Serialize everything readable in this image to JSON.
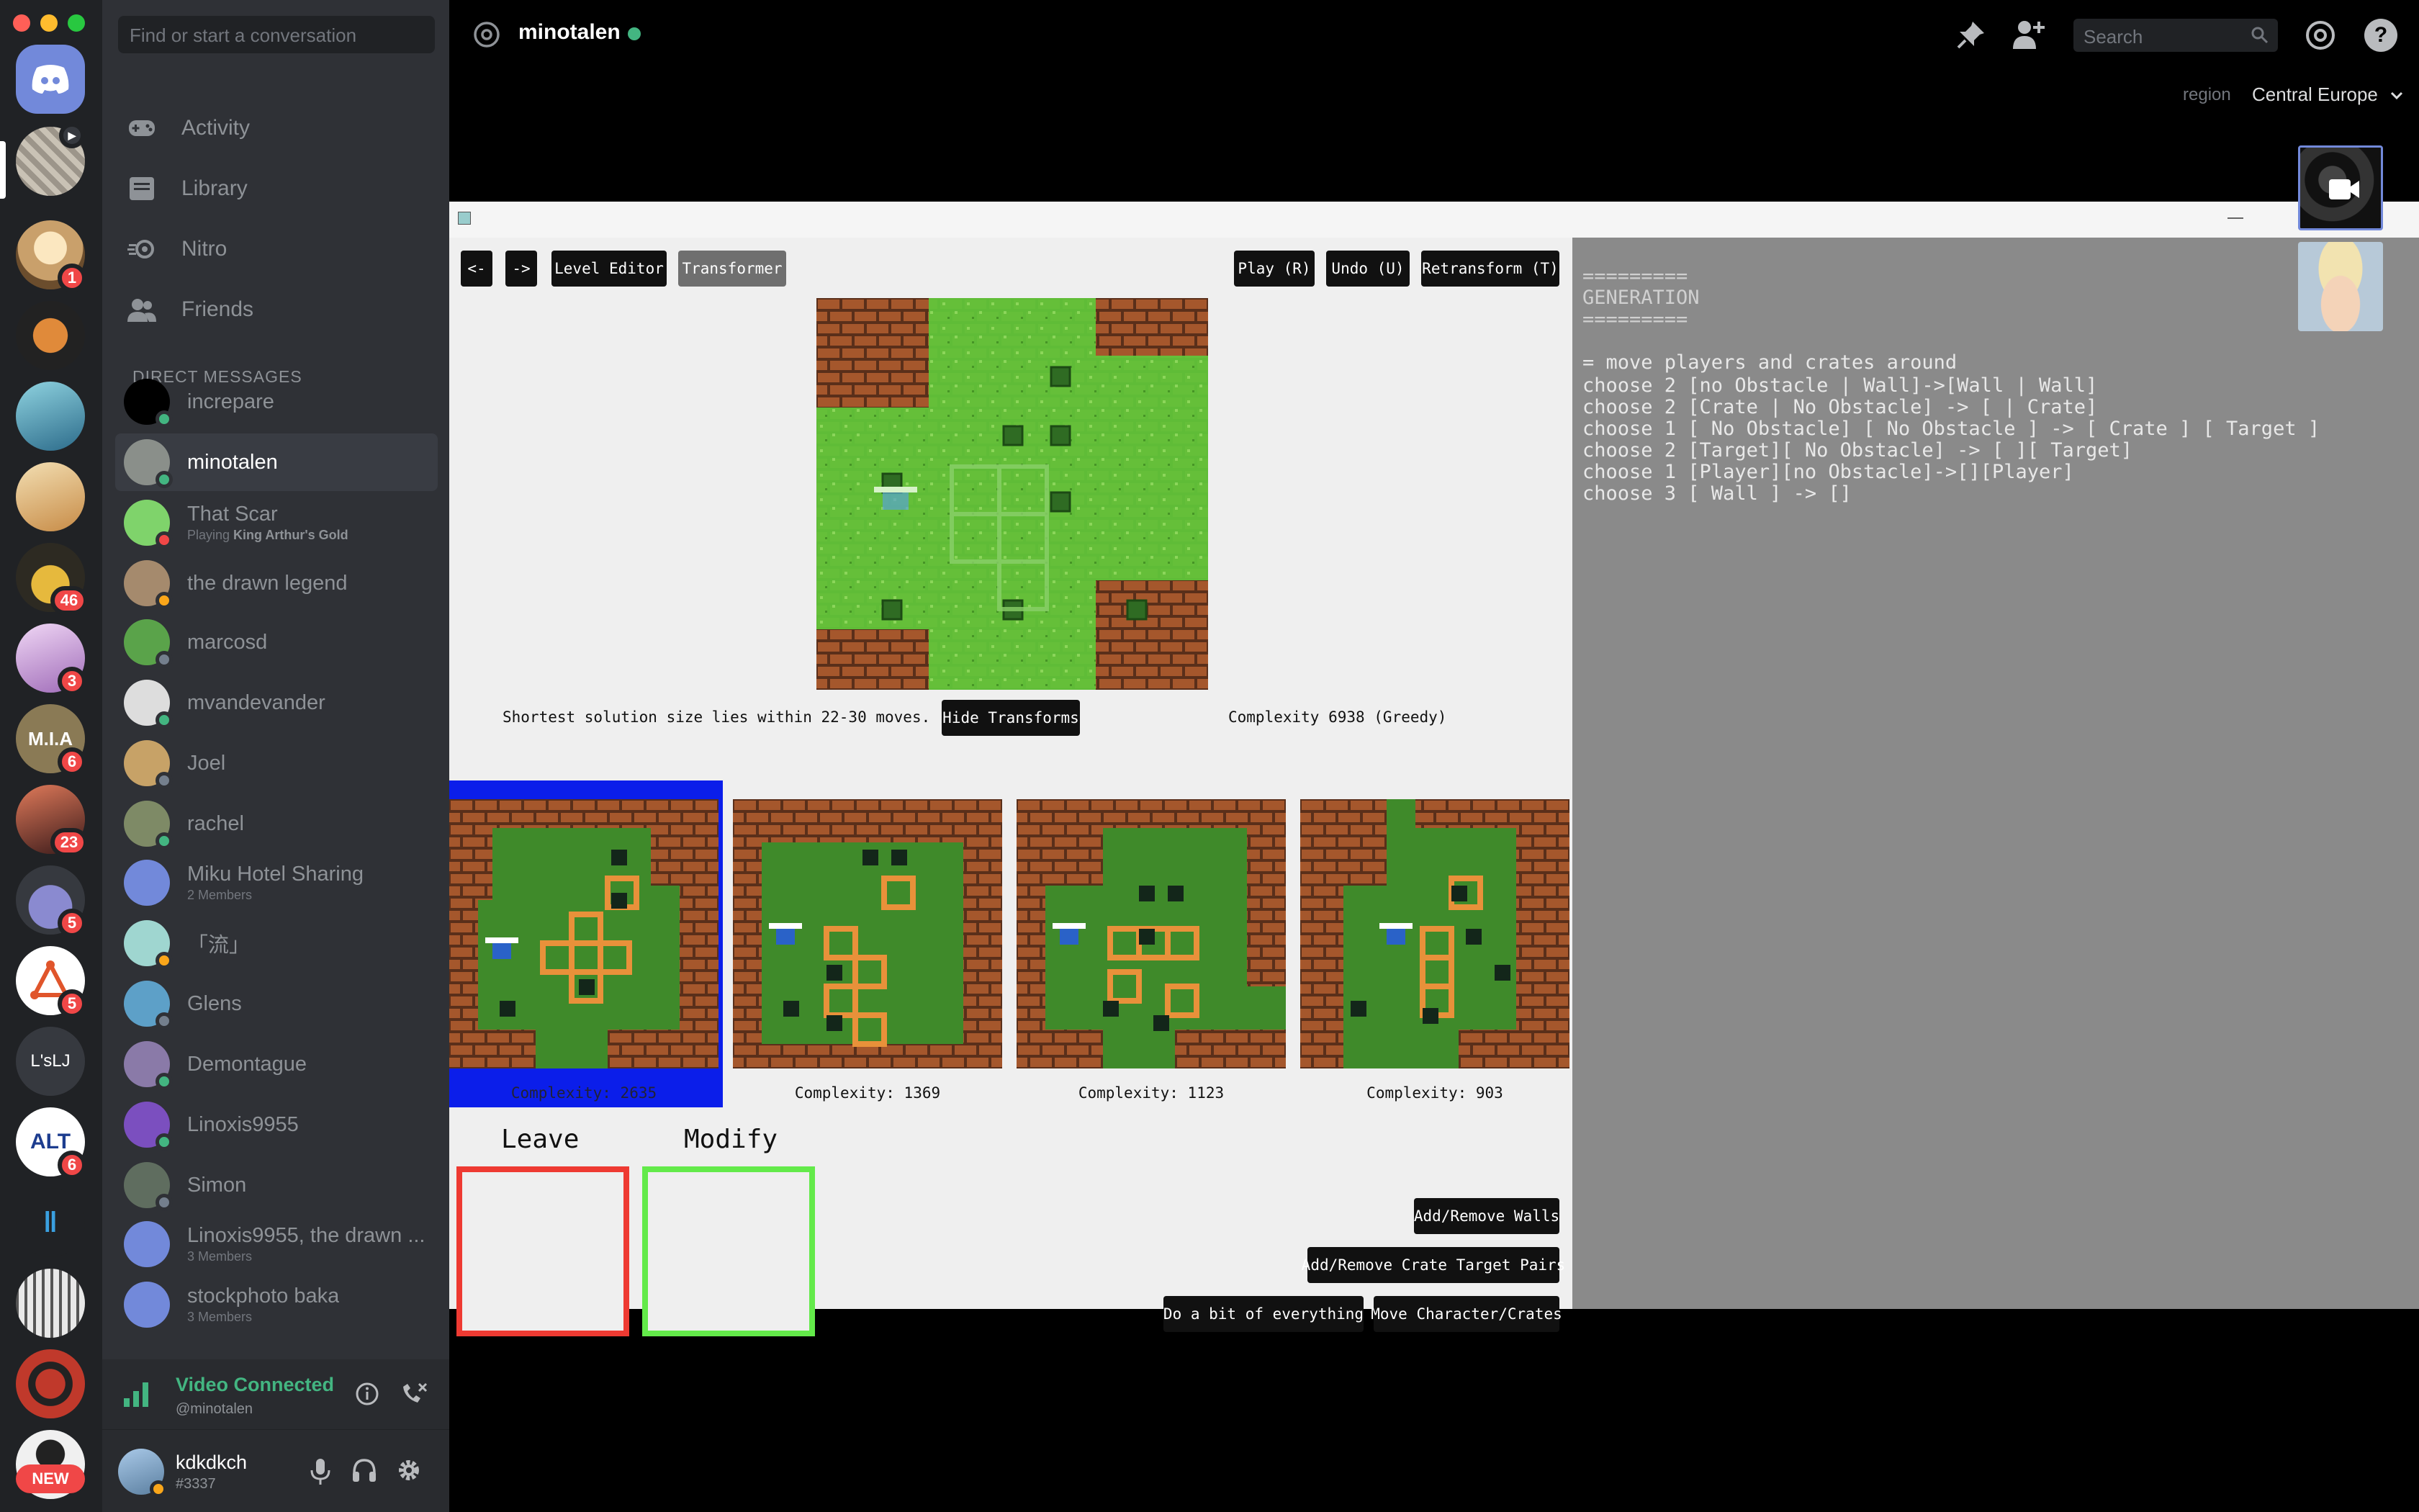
{
  "sidebar": {
    "search_placeholder": "Find or start a conversation",
    "nav": [
      {
        "label": "Activity",
        "icon": "gamepad-icon"
      },
      {
        "label": "Library",
        "icon": "library-icon"
      },
      {
        "label": "Nitro",
        "icon": "nitro-icon"
      },
      {
        "label": "Friends",
        "icon": "friends-icon"
      }
    ],
    "dm_header": "DIRECT MESSAGES",
    "dms": [
      {
        "name": "increpare",
        "sub": "",
        "sub_bold": "",
        "status": "#43b581",
        "avatar": "#000000"
      },
      {
        "name": "minotalen",
        "sub": "",
        "sub_bold": "",
        "status": "#43b581",
        "avatar": "#8a8f8a"
      },
      {
        "name": "That Scar",
        "sub": "Playing ",
        "sub_bold": "King Arthur's Gold",
        "status": "#f04747",
        "avatar": "#7fd36b"
      },
      {
        "name": "the drawn legend",
        "sub": "",
        "sub_bold": "",
        "status": "#faa61a",
        "avatar": "#a58a6d"
      },
      {
        "name": "marcosd",
        "sub": "",
        "sub_bold": "",
        "status": "#747f8d",
        "avatar": "#5aa34a"
      },
      {
        "name": "mvandevander",
        "sub": "",
        "sub_bold": "",
        "status": "#43b581",
        "avatar": "#dddddd"
      },
      {
        "name": "Joel",
        "sub": "",
        "sub_bold": "",
        "status": "#747f8d",
        "avatar": "#c7a267"
      },
      {
        "name": "rachel",
        "sub": "",
        "sub_bold": "",
        "status": "#43b581",
        "avatar": "#7e8a66"
      },
      {
        "name": "Miku Hotel Sharing",
        "sub": "2 Members",
        "sub_bold": "",
        "status": "",
        "avatar": "#7289da"
      },
      {
        "name": "「流」",
        "sub": "",
        "sub_bold": "",
        "status": "#faa61a",
        "avatar": "#9fd6d0"
      },
      {
        "name": "Glens",
        "sub": "",
        "sub_bold": "",
        "status": "#747f8d",
        "avatar": "#5da0c8"
      },
      {
        "name": "Demontague",
        "sub": "",
        "sub_bold": "",
        "status": "#43b581",
        "avatar": "#8a7aa8"
      },
      {
        "name": "Linoxis9955",
        "sub": "",
        "sub_bold": "",
        "status": "#43b581",
        "avatar": "#7b4fbf"
      },
      {
        "name": "Simon",
        "sub": "",
        "sub_bold": "",
        "status": "#747f8d",
        "avatar": "#5f6d5f"
      },
      {
        "name": "Linoxis9955, the drawn ...",
        "sub": "3 Members",
        "sub_bold": "",
        "status": "",
        "avatar": "#7289da"
      },
      {
        "name": "stockphoto baka",
        "sub": "3 Members",
        "sub_bold": "",
        "status": "",
        "avatar": "#7289da"
      }
    ]
  },
  "rail": {
    "badges": [
      "1",
      "46",
      "3",
      "6",
      "23",
      "5",
      "5",
      "6"
    ],
    "text_server": "L'sLJ",
    "new_label": "NEW"
  },
  "voice": {
    "status": "Video Connected",
    "channel": "@minotalen"
  },
  "user": {
    "name": "kdkdkch",
    "tag": "#3337"
  },
  "header": {
    "channel": "minotalen",
    "search_placeholder": "Search",
    "region_label": "region",
    "region_value": "Central Europe"
  },
  "app": {
    "buttons": {
      "back": "<-",
      "forward": "->",
      "level_editor": "Level Editor",
      "transformer": "Transformer",
      "play": "Play (R)",
      "undo": "Undo (U)",
      "retransform": "Retransform (T)",
      "hide_transforms": "Hide Transforms",
      "add_remove_walls": "Add/Remove Walls",
      "add_remove_pairs": "Add/Remove Crate Target Pairs",
      "do_everything": "Do a bit of everything",
      "move_character": "Move Character/Crates"
    },
    "solution_text": "Shortest solution size lies within 22-30 moves.",
    "complexity_text": "Complexity 6938 (Greedy)",
    "thumbs": [
      {
        "label": "Complexity: 2635"
      },
      {
        "label": "Complexity: 1369"
      },
      {
        "label": "Complexity: 1123"
      },
      {
        "label": "Complexity: 903"
      }
    ],
    "leave_label": "Leave",
    "modify_label": "Modify",
    "generation_lines": [
      "=========",
      "GENERATION",
      "=========",
      "",
      "= move players and crates around",
      "choose 2 [no Obstacle | Wall]->[Wall | Wall]",
      "choose 2 [Crate | No Obstacle] -> [ | Crate]",
      "choose 1 [ No Obstacle] [ No Obstacle ] -> [ Crate ] [ Target ]",
      "choose 2 [Target][ No Obstacle] -> [ ][ Target]",
      "choose 1 [Player][no Obstacle]->[][Player]",
      "choose 3 [ Wall ] -> []"
    ]
  },
  "colors": {
    "rail": "#202225",
    "sidebar": "#2f3136",
    "accent": "#7289da",
    "online": "#43b581",
    "mention": "#f04747",
    "video_green": "#43b581"
  }
}
